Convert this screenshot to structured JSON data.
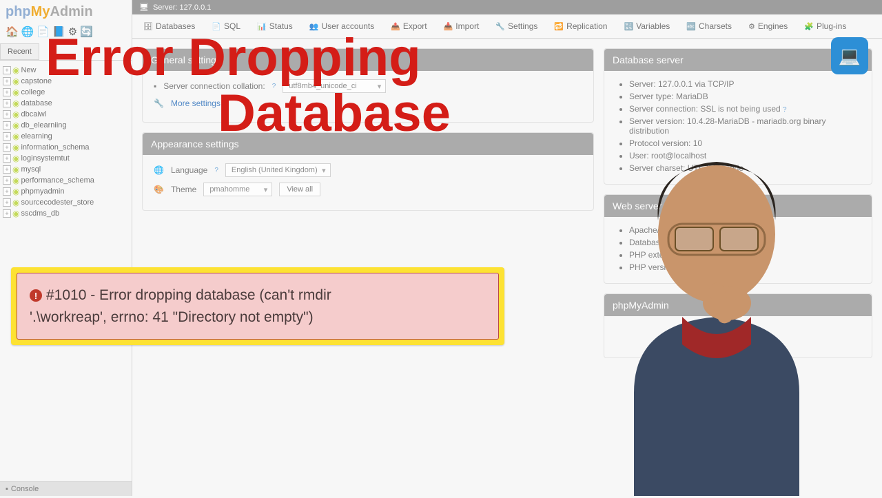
{
  "logo": {
    "php": "php",
    "my": "My",
    "admin": "Admin"
  },
  "sidebar_tabs": {
    "recent": "Recent"
  },
  "databases": [
    "New",
    "capstone",
    "college",
    "database",
    "dbcaiwl",
    "db_elearniing",
    "elearning",
    "information_schema",
    "loginsystemtut",
    "mysql",
    "performance_schema",
    "phpmyadmin",
    "sourcecodester_store",
    "sscdms_db"
  ],
  "console": "Console",
  "server_bar": "Server: 127.0.0.1",
  "top_tabs": [
    "Databases",
    "SQL",
    "Status",
    "User accounts",
    "Export",
    "Import",
    "Settings",
    "Replication",
    "Variables",
    "Charsets",
    "Engines",
    "Plug-ins"
  ],
  "general": {
    "head": "General settings",
    "collation_label": "Server connection collation:",
    "collation_value": "utf8mb4_unicode_ci",
    "more": "More settings"
  },
  "appearance": {
    "head": "Appearance settings",
    "lang_label": "Language",
    "lang_value": "English (United Kingdom)",
    "theme_label": "Theme",
    "theme_value": "pmahomme",
    "viewall": "View all"
  },
  "db_server": {
    "head": "Database server",
    "items": [
      "Server: 127.0.0.1 via TCP/IP",
      "Server type: MariaDB",
      "Server connection: SSL is not being used",
      "Server version: 10.4.28-MariaDB - mariadb.org binary distribution",
      "Protocol version: 10",
      "User: root@localhost",
      "Server charset: UTF-8 Unicode"
    ]
  },
  "web_server": {
    "head": "Web server",
    "items": [
      "Apache/2.4.56 (Win64)",
      "Database client version",
      "PHP extension: mysqli",
      "PHP version: 8.2.4"
    ]
  },
  "pma_panel": {
    "head": "phpMyAdmin"
  },
  "overlay_title_a": "Error Dropping",
  "overlay_title_b": "Database",
  "error": {
    "line1": "#1010 - Error dropping database (can't rmdir",
    "line2": "'.\\workreap', errno: 41 \"Directory not empty\")"
  }
}
